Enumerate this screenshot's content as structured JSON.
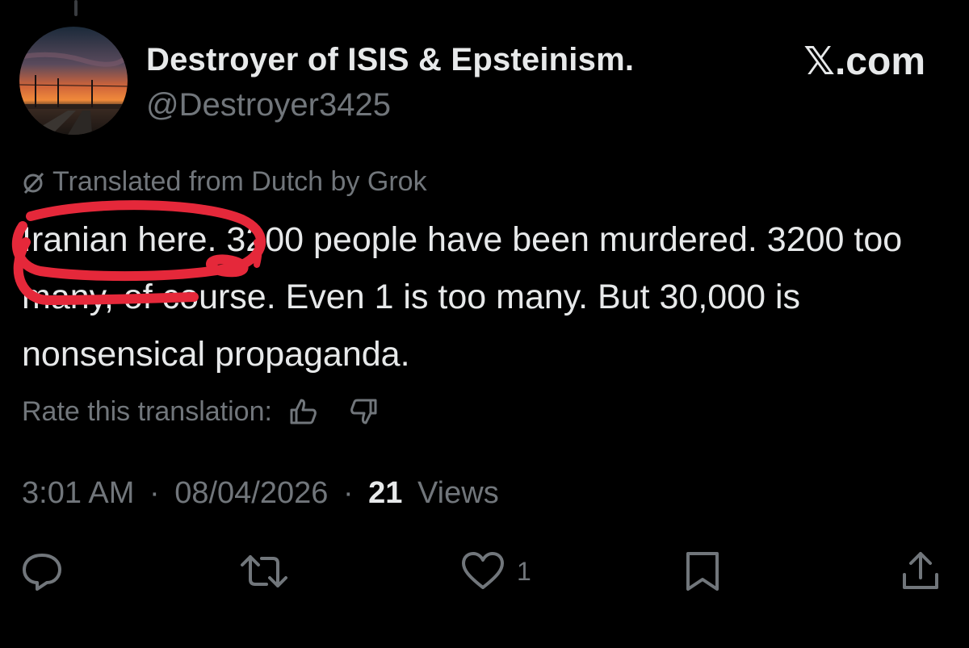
{
  "tweet": {
    "author": {
      "display_name": "Destroyer of ISIS & Epsteinism.",
      "handle": "@Destroyer3425"
    },
    "brand": "𝕏.com",
    "translation_note": "Translated from Dutch by Grok",
    "text": "Iranian here. 3200 people have been murdered. 3200 too many, of course. Even 1 is too many. But 30,000 is nonsensical propaganda.",
    "rate_label": "Rate this translation:",
    "time": "3:01 AM",
    "date": "08/04/2026",
    "separator": "·",
    "views_count": "21",
    "views_label": "Views",
    "actions": {
      "reply_icon": "reply-icon",
      "retweet_icon": "retweet-icon",
      "like_icon": "heart-icon",
      "like_count": "1",
      "bookmark_icon": "bookmark-icon",
      "share_icon": "share-icon"
    }
  },
  "colors": {
    "background": "#000000",
    "primary_text": "#e7e9ea",
    "secondary_text": "#71767b",
    "annotation": "#e5283a"
  }
}
